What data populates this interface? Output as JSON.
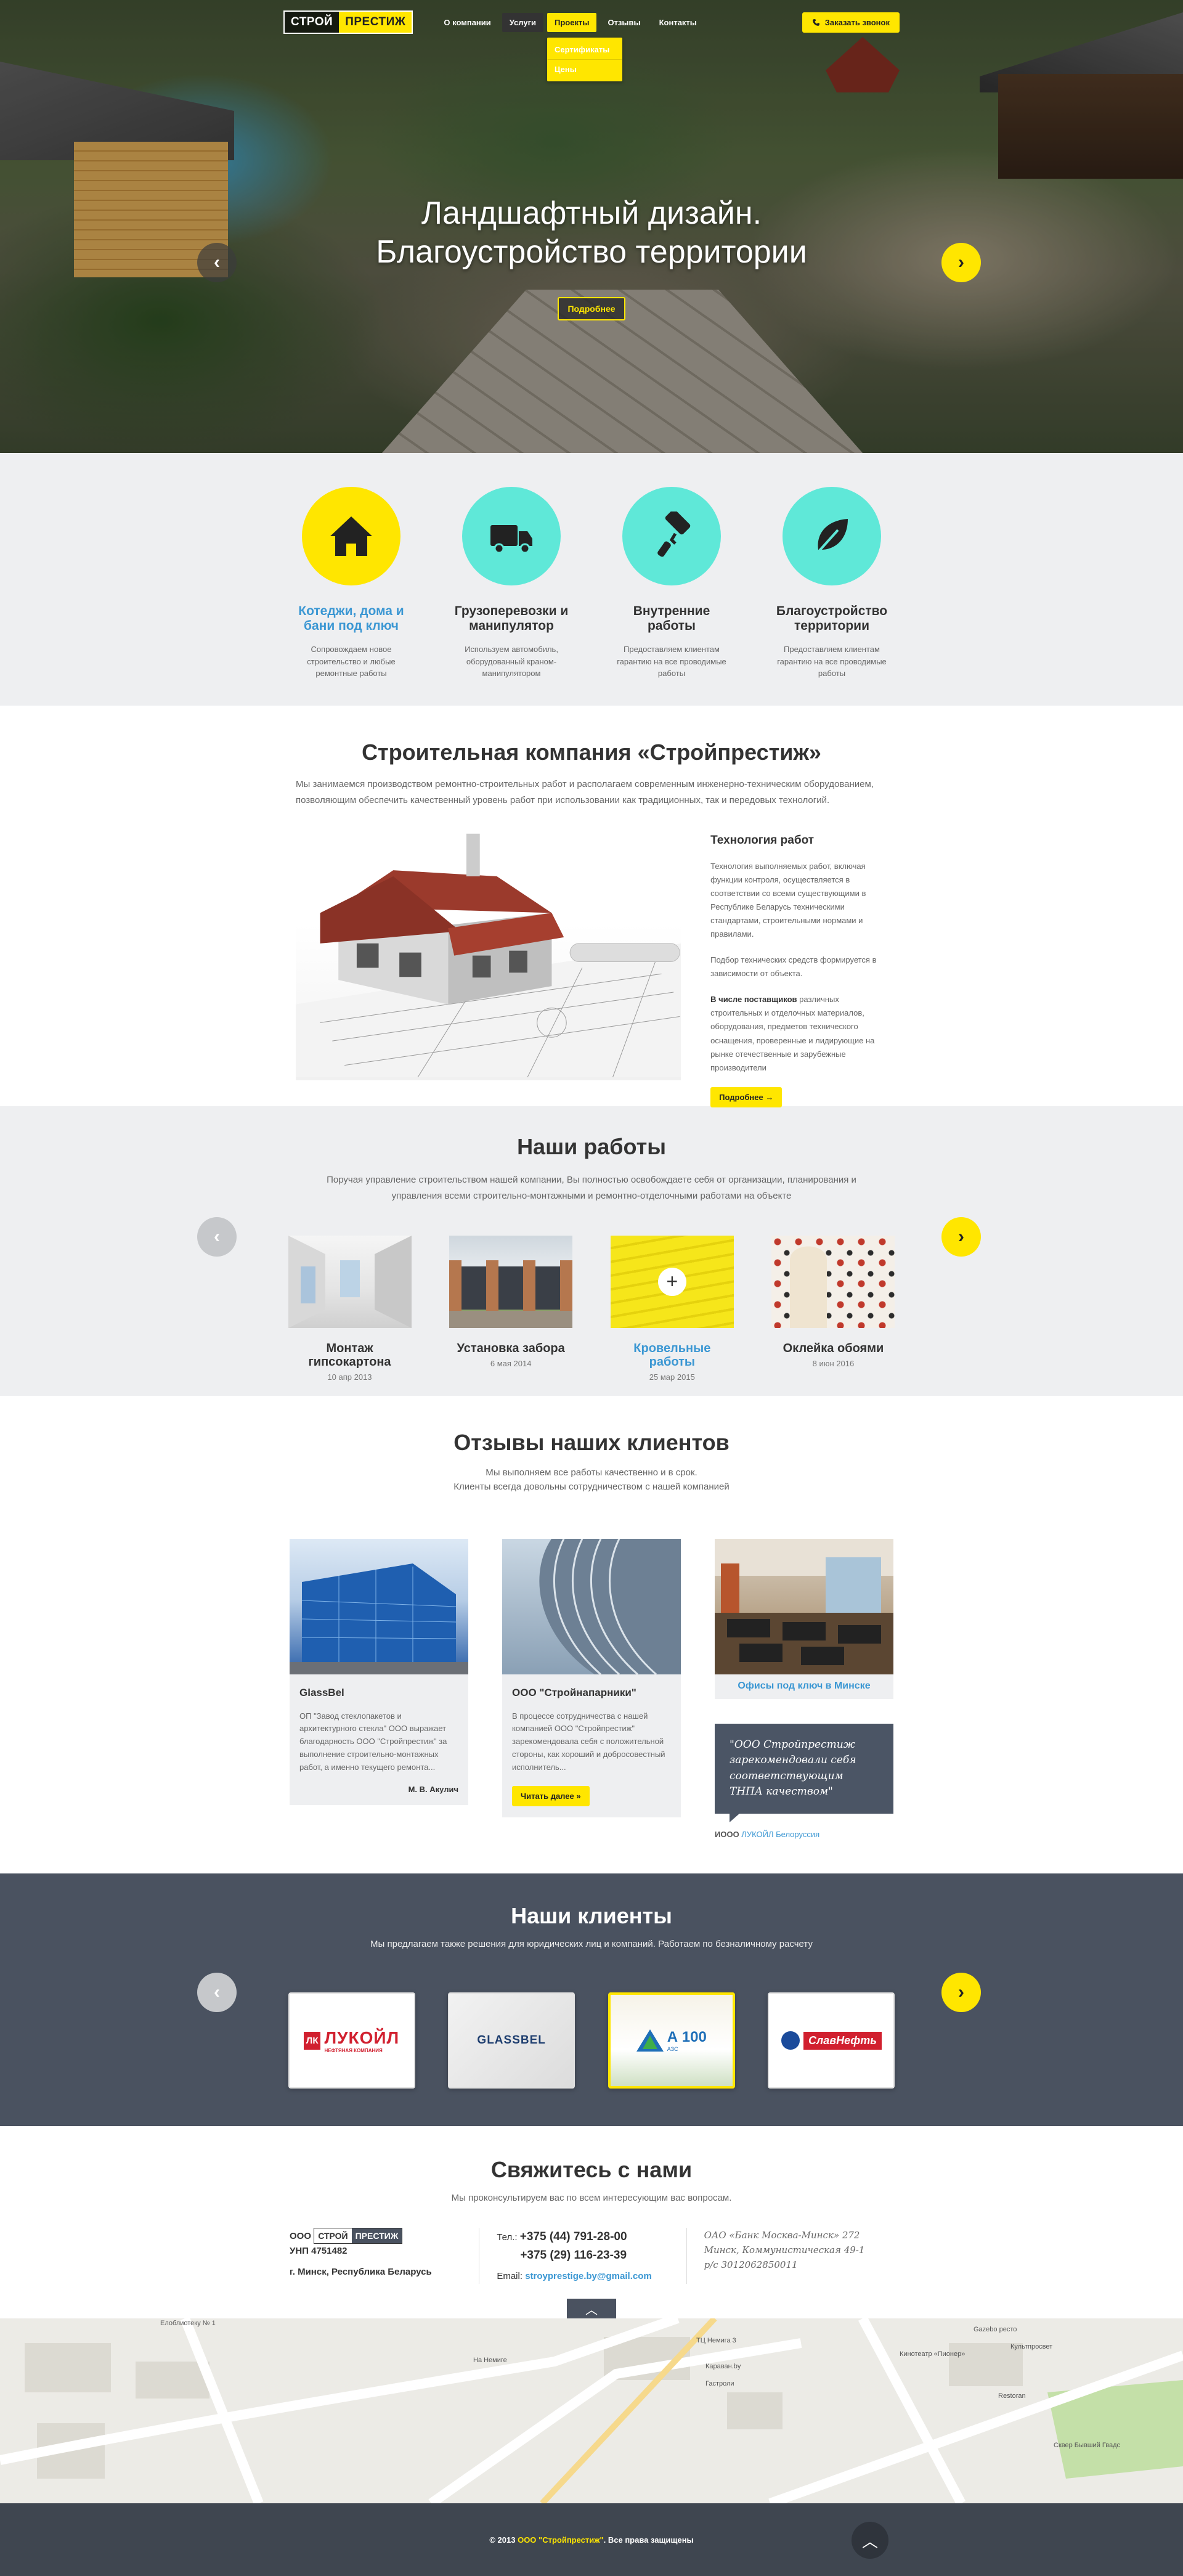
{
  "header": {
    "logo_left": "СТРОЙ",
    "logo_right": "ПРЕСТИЖ",
    "nav": [
      {
        "label": "О компании"
      },
      {
        "label": "Услуги"
      },
      {
        "label": "Проекты"
      },
      {
        "label": "Отзывы"
      },
      {
        "label": "Контакты"
      }
    ],
    "dropdown": [
      "Сертификаты",
      "Цены"
    ],
    "call_button": "Заказать звонок"
  },
  "hero": {
    "title_line1": "Ландшафтный дизайн.",
    "title_line2": "Благоустройство территории",
    "button": "Подробнее",
    "prev_icon": "‹",
    "next_icon": "›"
  },
  "services": [
    {
      "title": "Котеджи, дома и бани под ключ",
      "text": "Сопровождаем новое строительство и любые ремонтные работы",
      "icon": "house-icon"
    },
    {
      "title": "Грузоперевозки и манипулятор",
      "text": "Используем автомобиль, оборудованный краном-манипулятором",
      "icon": "truck-icon"
    },
    {
      "title": "Внутренние работы",
      "text": "Предоставляем клиентам гарантию на все проводимые работы",
      "icon": "paint-roller-icon"
    },
    {
      "title": "Благоустройство территории",
      "text": "Предоставляем клиентам гарантию на все проводимые работы",
      "icon": "leaf-icon"
    }
  ],
  "about": {
    "title": "Строительная компания «Стройпрестиж»",
    "intro": "Мы занимаемся производством ремонтно-строительных работ и располагаем современным инженерно-техническим оборудованием, позволяющим обеспечить качественный уровень работ при использовании как традиционных, так и передовых технологий.",
    "side_title": "Технология работ",
    "p1": "Технология выполняемых работ, включая функции контроля, осуществляется в соответствии со всеми существующими в Республике Беларусь техническими стандартами, строительными нормами и правилами.",
    "p2": "Подбор технических средств формируется в зависимости от объекта.",
    "p3_bold": "В числе поставщиков",
    "p3_rest": " различных строительных и отделочных материалов, оборудования, предметов технического оснащения, проверенные и лидирующие на рынке отечественные и зарубежные производители",
    "button": "Подробнее →"
  },
  "works": {
    "title": "Наши работы",
    "intro_line1": "Поручая управление строительством нашей компании, Вы полностью освобождаете себя от организации, планирования и",
    "intro_line2": "управления всеми строительно-монтажными и ремонтно-отделочными работами на объекте",
    "items": [
      {
        "title": "Монтаж гипсокартона",
        "date": "10 апр 2013"
      },
      {
        "title": "Установка забора",
        "date": "6 мая 2014"
      },
      {
        "title": "Кровельные работы",
        "date": "25 мар 2015"
      },
      {
        "title": "Оклейка обоями",
        "date": "8 июн 2016"
      }
    ],
    "plus": "+"
  },
  "reviews": {
    "title": "Отзывы наших клиентов",
    "sub_line1": "Мы выполняем все работы качественно и в срок.",
    "sub_line2": "Клиенты всегда довольны сотрудничеством с нашей компанией",
    "card1": {
      "name": "GlassBel",
      "text": "ОП \"Завод стеклопакетов и архитектурного стекла\" ООО выражает благодарность ООО \"Стройпрестиж\" за выполнение строительно-монтажных работ, а именно текущего ремонта...",
      "sign": "М. В. Акулич"
    },
    "card2": {
      "name": "ООО \"Стройнапарники\"",
      "text": "В процессе сотрудничества с нашей компанией ООО \"Стройпрестиж\" зарекомендовала себя с положительной стороны, как хороший и добросовестный исполнитель...",
      "button": "Читать далее »"
    },
    "card3": {
      "caption": "Офисы под ключ в Минске",
      "quote": "\"ООО Стройпрестиж зарекомендовали себя соответствующим ТНПА качеством\"",
      "author_prefix": "ИООО ",
      "author_link": "ЛУКОЙЛ Белоруссия"
    }
  },
  "clients": {
    "title": "Наши клиенты",
    "sub": "Мы предлагаем также решения для юридических лиц и компаний. Работаем по безналичному расчету",
    "logos": [
      {
        "name": "ЛУКОЙЛ",
        "sub": "НЕФТЯНАЯ КОМПАНИЯ",
        "mark": "ЛК"
      },
      {
        "name": "GLASSBEL"
      },
      {
        "name": "А 100",
        "sub": "АЗС"
      },
      {
        "name": "СлавНефть"
      }
    ]
  },
  "contacts": {
    "title": "Свяжитесь с нами",
    "sub": "Мы проконсультируем вас по всем интересующим вас вопросам.",
    "company_prefix": "ООО",
    "logo_left": "СТРОЙ",
    "logo_right": "ПРЕСТИЖ",
    "unp": "УНП 4751482",
    "city": "г. Минск, Республика Беларусь",
    "tel_label": "Тел.:",
    "phone1": "+375 (44) 791-28-00",
    "phone2": "+375 (29) 116-23-39",
    "email_label": "Email:",
    "email": "stroyprestige.by@gmail.com",
    "bank1": "ОАО «Банк Москва-Минск» 272",
    "bank2": "Минск, Коммунистическая 49-1",
    "bank3": "р/с 3012062850011",
    "up_icon": "︿"
  },
  "map": {
    "labels": [
      "Елоблиотеку № 1",
      "На Немиге",
      "ТЦ Немига 3",
      "Караван.by",
      "Гастроли",
      "Кинотеатр «Пионер»",
      "Gazebo ресто",
      "Культпросвет",
      "Restoran",
      "Сквер Бывший Гвадс"
    ]
  },
  "footer": {
    "prefix": "© 2013 ",
    "company": "ООО \"Стройпрестиж\"",
    "suffix": ". Все права защищены",
    "top_icon": "︿"
  },
  "colors": {
    "accent": "#ffe600",
    "teal": "#5fe8d8",
    "blue": "#3b97d3",
    "dark": "#4a5260"
  }
}
